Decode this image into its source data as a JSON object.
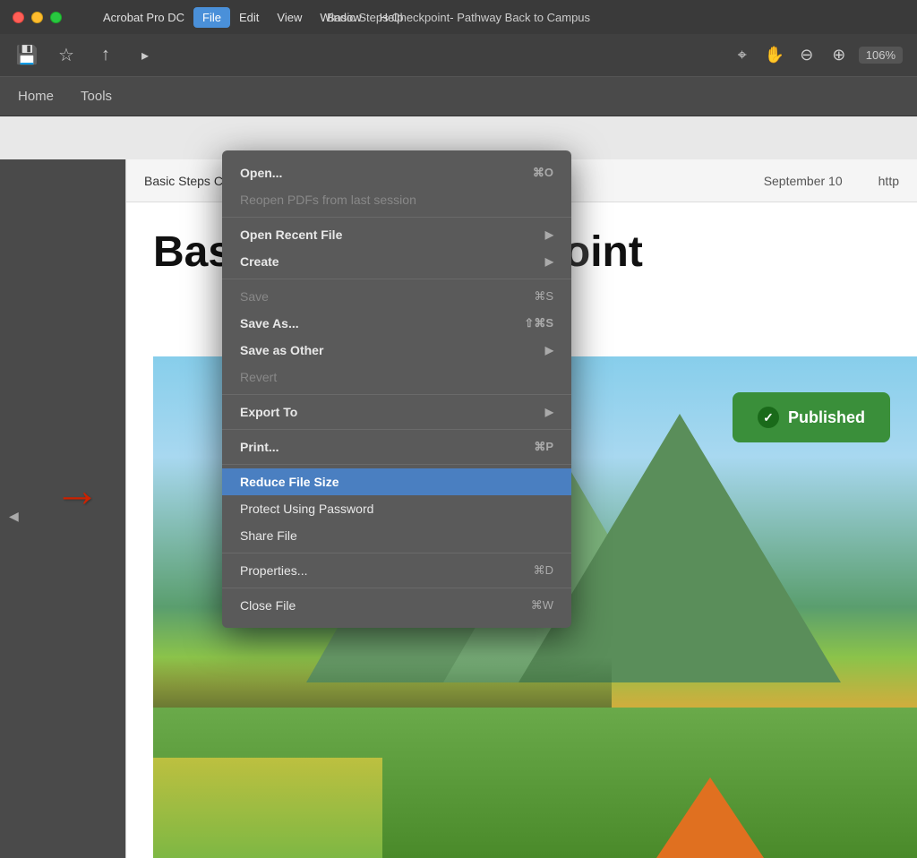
{
  "app": {
    "name": "Acrobat Pro DC"
  },
  "titleBar": {
    "appleSymbol": "",
    "windowTitle": "Basic Steps Checkpoint- Pathway Back to Campus -",
    "menus": [
      "",
      "Acrobat Pro DC",
      "File",
      "Edit",
      "View",
      "Window",
      "Help"
    ]
  },
  "fileMenu": {
    "label": "File",
    "items": [
      {
        "id": "open",
        "label": "Open...",
        "shortcut": "⌘O",
        "bold": true,
        "disabled": false,
        "separator_after": false
      },
      {
        "id": "reopen",
        "label": "Reopen PDFs from last session",
        "shortcut": "",
        "bold": false,
        "disabled": true,
        "separator_after": true
      },
      {
        "id": "open-recent",
        "label": "Open Recent File",
        "shortcut": "",
        "bold": true,
        "hasArrow": true,
        "separator_after": false
      },
      {
        "id": "create",
        "label": "Create",
        "shortcut": "",
        "bold": true,
        "hasArrow": true,
        "separator_after": true
      },
      {
        "id": "save",
        "label": "Save",
        "shortcut": "⌘S",
        "bold": false,
        "disabled": true,
        "separator_after": false
      },
      {
        "id": "save-as",
        "label": "Save As...",
        "shortcut": "⇧⌘S",
        "bold": true,
        "separator_after": false
      },
      {
        "id": "save-as-other",
        "label": "Save as Other",
        "shortcut": "",
        "bold": true,
        "hasArrow": true,
        "separator_after": false
      },
      {
        "id": "revert",
        "label": "Revert",
        "shortcut": "",
        "bold": false,
        "disabled": true,
        "separator_after": true
      },
      {
        "id": "export-to",
        "label": "Export To",
        "shortcut": "",
        "bold": true,
        "hasArrow": true,
        "separator_after": true
      },
      {
        "id": "print",
        "label": "Print...",
        "shortcut": "⌘P",
        "bold": true,
        "separator_after": true
      },
      {
        "id": "reduce-file-size",
        "label": "Reduce File Size",
        "shortcut": "",
        "bold": true,
        "highlighted": true,
        "separator_after": false
      },
      {
        "id": "protect-password",
        "label": "Protect Using Password",
        "shortcut": "",
        "bold": false,
        "separator_after": false
      },
      {
        "id": "share-file",
        "label": "Share File",
        "shortcut": "",
        "bold": false,
        "separator_after": true
      },
      {
        "id": "properties",
        "label": "Properties...",
        "shortcut": "⌘D",
        "bold": false,
        "separator_after": true
      },
      {
        "id": "close-file",
        "label": "Close File",
        "shortcut": "⌘W",
        "bold": false,
        "separator_after": false
      }
    ]
  },
  "toolbar": {
    "zoom": "106%",
    "saveIcon": "💾",
    "bookmarkIcon": "☆",
    "uploadIcon": "↑"
  },
  "appNav": {
    "items": [
      "Home",
      "Tools"
    ]
  },
  "document": {
    "title": "Basic Steps Checkpoint- Pathway Back to Campus",
    "date": "September 10",
    "url": "http",
    "heading": "Basic Steps Checkpoint",
    "publishedLabel": "Published"
  },
  "published": {
    "label": "Published",
    "checkIcon": "✓",
    "bgColor": "#3a8f3a"
  },
  "arrow": {
    "symbol": "→",
    "color": "#cc2200"
  }
}
